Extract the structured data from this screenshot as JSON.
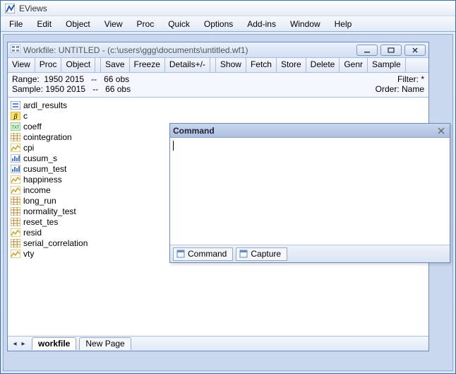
{
  "app": {
    "title": "EViews"
  },
  "menu": [
    "File",
    "Edit",
    "Object",
    "View",
    "Proc",
    "Quick",
    "Options",
    "Add-ins",
    "Window",
    "Help"
  ],
  "workfile": {
    "title": "Workfile: UNTITLED - (c:\\users\\ggg\\documents\\untitled.wf1)",
    "toolbar_a": [
      "View",
      "Proc",
      "Object"
    ],
    "toolbar_b": [
      "Save",
      "Freeze",
      "Details+/-"
    ],
    "toolbar_c": [
      "Show",
      "Fetch",
      "Store",
      "Delete",
      "Genr",
      "Sample"
    ],
    "range_label": "Range:  1950 2015   --   66 obs",
    "sample_label": "Sample: 1950 2015   --   66 obs",
    "filter_label": "Filter: *",
    "order_label": "Order: Name",
    "objects": [
      {
        "name": "ardl_results",
        "icon": "equation"
      },
      {
        "name": "c",
        "icon": "coef"
      },
      {
        "name": "coeff",
        "icon": "text"
      },
      {
        "name": "cointegration",
        "icon": "table"
      },
      {
        "name": "cpi",
        "icon": "series"
      },
      {
        "name": "cusum_s",
        "icon": "graph"
      },
      {
        "name": "cusum_test",
        "icon": "graph"
      },
      {
        "name": "happiness",
        "icon": "series"
      },
      {
        "name": "income",
        "icon": "series"
      },
      {
        "name": "long_run",
        "icon": "table"
      },
      {
        "name": "normality_test",
        "icon": "table"
      },
      {
        "name": "reset_tes",
        "icon": "table"
      },
      {
        "name": "resid",
        "icon": "series"
      },
      {
        "name": "serial_correlation",
        "icon": "table"
      },
      {
        "name": "vty",
        "icon": "series"
      }
    ],
    "tabs": {
      "active": "workfile",
      "new": "New Page"
    }
  },
  "command": {
    "title": "Command",
    "tabs": [
      "Command",
      "Capture"
    ]
  }
}
